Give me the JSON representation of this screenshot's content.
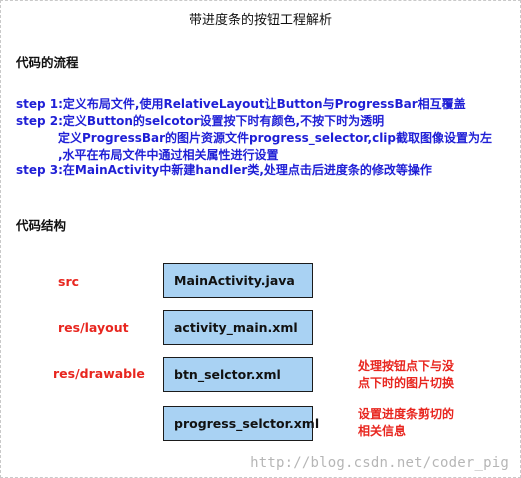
{
  "title": "带进度条的按钮工程解析",
  "flow": {
    "heading": "代码的流程",
    "steps": [
      "step 1:定义布局文件,使用RelativeLayout让Button与ProgressBar相互覆盖",
      "step 2:定义Button的selcotor设置按下时有颜色,不按下时为透明",
      "定义ProgressBar的图片资源文件progress_selector,clip截取图像设置为左",
      ",水平在布局文件中通过相关属性进行设置",
      "step 3:在MainActivity中新建handler类,处理点击后进度条的修改等操作"
    ]
  },
  "structure": {
    "heading": "代码结构",
    "labels": {
      "src": "src",
      "layout": "res/layout",
      "drawable": "res/drawable"
    },
    "files": [
      "MainActivity.java",
      "activity_main.xml",
      "btn_selctor.xml",
      "progress_selctor.xml"
    ],
    "notes": {
      "btn": [
        "处理按钮点下与没",
        "点下时的图片切换"
      ],
      "progress": [
        "设置进度条剪切的",
        "相关信息"
      ]
    }
  },
  "watermark": "http://blog.csdn.net/coder_pig",
  "colors": {
    "step_text": "#1f1fd6",
    "label_text": "#e8261f",
    "box_fill": "#a9d2f3",
    "box_border": "#1b1b1b"
  }
}
